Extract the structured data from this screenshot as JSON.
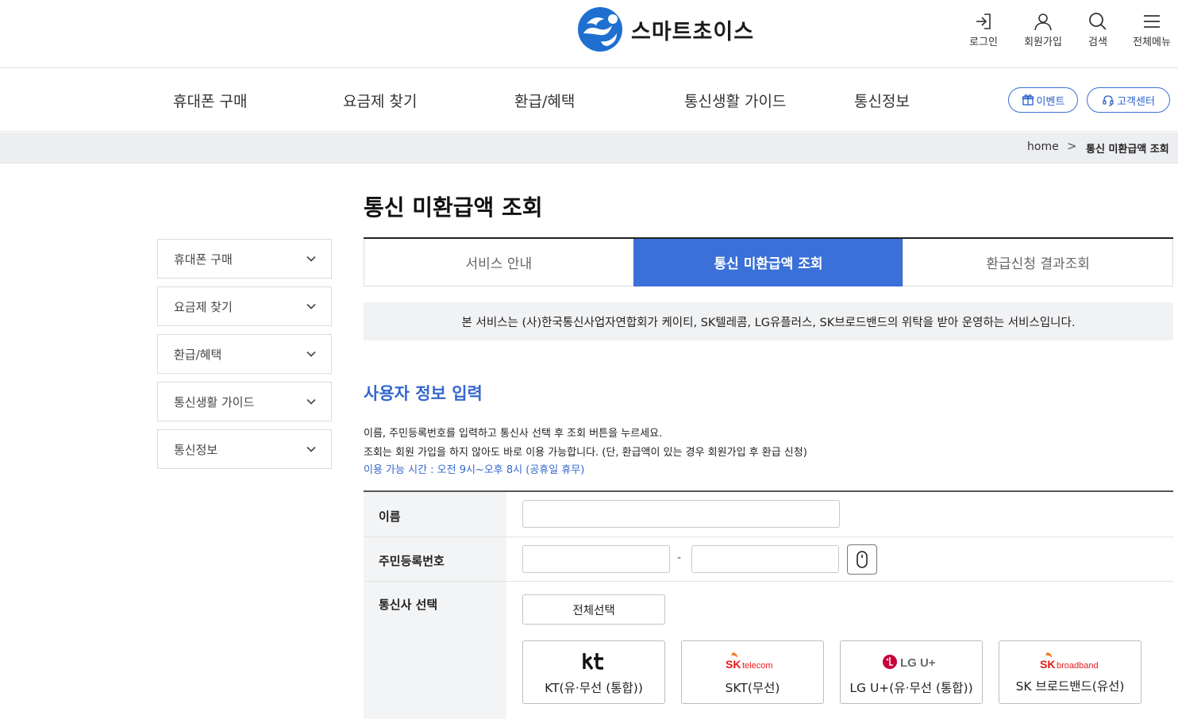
{
  "header": {
    "brand": "스마트초이스",
    "util": [
      {
        "label": "로그인",
        "icon": "login-icon"
      },
      {
        "label": "회원가입",
        "icon": "user-icon"
      },
      {
        "label": "검색",
        "icon": "search-icon"
      },
      {
        "label": "전체메뉴",
        "icon": "menu-icon"
      }
    ]
  },
  "gnb": {
    "items": [
      "휴대폰 구매",
      "요금제 찾기",
      "환급/혜택",
      "통신생활 가이드",
      "통신정보"
    ],
    "event_label": "이벤트",
    "support_label": "고객센터"
  },
  "breadcrumb": {
    "home": "home",
    "separator": ">",
    "current": "통신 미환급액 조회"
  },
  "sidebar": {
    "items": [
      "휴대폰 구매",
      "요금제 찾기",
      "환급/혜택",
      "통신생활 가이드",
      "통신정보"
    ]
  },
  "main": {
    "title": "통신 미환급액 조회",
    "tabs": [
      {
        "label": "서비스 안내"
      },
      {
        "label": "통신 미환급액 조회"
      },
      {
        "label": "환급신청 결과조회"
      }
    ],
    "notice": "본 서비스는 (사)한국통신사업자연합회가 케이티, SK텔레콤, LG유플러스, SK브로드밴드의 위탁을 받아 운영하는 서비스입니다.",
    "section_title": "사용자 정보 입력",
    "desc1": "이름, 주민등록번호를 입력하고 통신사 선택 후 조회 버튼을 누르세요.",
    "desc2": "조회는 회원 가입을 하지 않아도 바로 이용 가능합니다. (단, 환급액이 있는 경우 회원가입 후 환급 신청)",
    "desc3": "이용 가능 시간 : 오전 9시~오후 8시 (공휴일 휴무)"
  },
  "form": {
    "name_label": "이름",
    "name_value": "",
    "rrn_label": "주민등록번호",
    "rrn_front": "",
    "rrn_back": "",
    "rrn_dash": "-",
    "carrier_label": "통신사 선택",
    "select_all": "전체선택",
    "carriers": [
      {
        "label": "KT(유·무선 (통합))",
        "logo": "kt",
        "color": "#111111"
      },
      {
        "label": "SKT(무선)",
        "logo_main": "SK",
        "logo_sub": "telecom",
        "color": "#ea1917"
      },
      {
        "label": "LG U+(유·무선 (통합))",
        "logo": "LG U+",
        "color": "#c8003a"
      },
      {
        "label": "SK 브로드밴드(유선)",
        "logo_main": "SK",
        "logo_sub": "broadband",
        "color": "#ea1917"
      }
    ]
  },
  "colors": {
    "accent": "#3b70d8",
    "accent_text": "#3467cf"
  }
}
